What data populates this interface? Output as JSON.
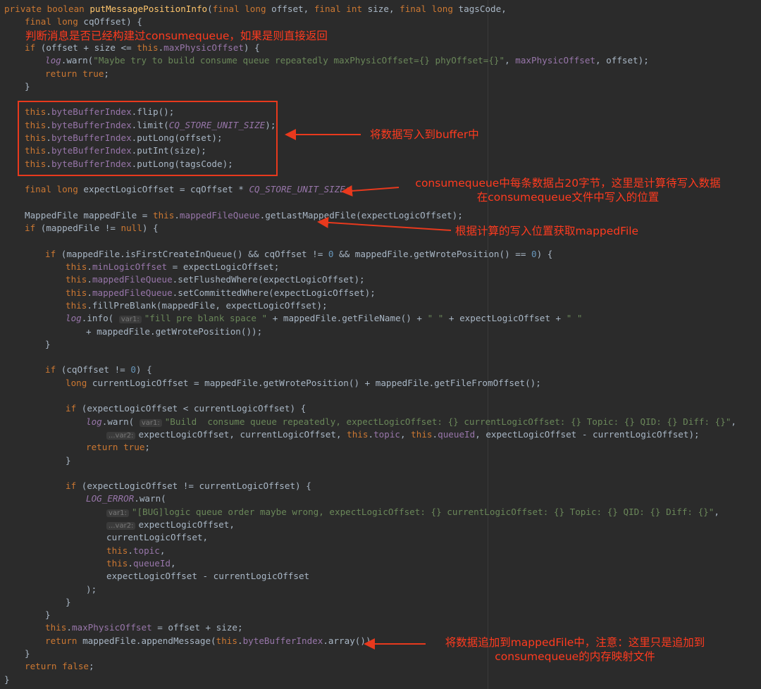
{
  "code_lines": [
    {
      "indent": 0,
      "segs": [
        {
          "t": "private boolean ",
          "c": "kw"
        },
        {
          "t": "putMessagePositionInfo",
          "c": "fn"
        },
        {
          "t": "("
        },
        {
          "t": "final long ",
          "c": "kw"
        },
        {
          "t": "offset, "
        },
        {
          "t": "final int ",
          "c": "kw"
        },
        {
          "t": "size, "
        },
        {
          "t": "final long ",
          "c": "kw"
        },
        {
          "t": "tagsCode,"
        }
      ]
    },
    {
      "indent": 1,
      "segs": [
        {
          "t": "final long ",
          "c": "kw"
        },
        {
          "t": "cqOffset) {"
        }
      ]
    },
    {
      "indent": 1,
      "blank": true,
      "segs": []
    },
    {
      "indent": 1,
      "segs": [
        {
          "t": "if ",
          "c": "kw"
        },
        {
          "t": "(offset + size <= "
        },
        {
          "t": "this",
          "c": "kw"
        },
        {
          "t": "."
        },
        {
          "t": "maxPhysicOffset",
          "c": "fld"
        },
        {
          "t": ") {"
        }
      ]
    },
    {
      "indent": 2,
      "segs": [
        {
          "t": "log",
          "c": "log"
        },
        {
          "t": ".warn("
        },
        {
          "t": "\"Maybe try to build consume queue repeatedly maxPhysicOffset={} phyOffset={}\"",
          "c": "str"
        },
        {
          "t": ", "
        },
        {
          "t": "maxPhysicOffset",
          "c": "fld"
        },
        {
          "t": ", offset);"
        }
      ]
    },
    {
      "indent": 2,
      "segs": [
        {
          "t": "return true",
          "c": "kw"
        },
        {
          "t": ";"
        }
      ]
    },
    {
      "indent": 1,
      "segs": [
        {
          "t": "}"
        }
      ]
    },
    {
      "indent": 1,
      "blank": true,
      "segs": []
    },
    {
      "indent": 1,
      "segs": [
        {
          "t": "this",
          "c": "kw"
        },
        {
          "t": "."
        },
        {
          "t": "byteBufferIndex",
          "c": "fld"
        },
        {
          "t": ".flip();"
        }
      ]
    },
    {
      "indent": 1,
      "segs": [
        {
          "t": "this",
          "c": "kw"
        },
        {
          "t": "."
        },
        {
          "t": "byteBufferIndex",
          "c": "fld"
        },
        {
          "t": ".limit("
        },
        {
          "t": "CQ_STORE_UNIT_SIZE",
          "c": "cst"
        },
        {
          "t": ");"
        }
      ]
    },
    {
      "indent": 1,
      "segs": [
        {
          "t": "this",
          "c": "kw"
        },
        {
          "t": "."
        },
        {
          "t": "byteBufferIndex",
          "c": "fld"
        },
        {
          "t": ".putLong(offset);"
        }
      ]
    },
    {
      "indent": 1,
      "segs": [
        {
          "t": "this",
          "c": "kw"
        },
        {
          "t": "."
        },
        {
          "t": "byteBufferIndex",
          "c": "fld"
        },
        {
          "t": ".putInt(size);"
        }
      ]
    },
    {
      "indent": 1,
      "segs": [
        {
          "t": "this",
          "c": "kw"
        },
        {
          "t": "."
        },
        {
          "t": "byteBufferIndex",
          "c": "fld"
        },
        {
          "t": ".putLong(tagsCode);"
        }
      ]
    },
    {
      "indent": 1,
      "blank": true,
      "segs": []
    },
    {
      "indent": 1,
      "segs": [
        {
          "t": "final long ",
          "c": "kw"
        },
        {
          "t": "expectLogicOffset = cqOffset * "
        },
        {
          "t": "CQ_STORE_UNIT_SIZE",
          "c": "cst"
        },
        {
          "t": ";"
        }
      ]
    },
    {
      "indent": 1,
      "blank": true,
      "segs": []
    },
    {
      "indent": 1,
      "segs": [
        {
          "t": "MappedFile mappedFile = "
        },
        {
          "t": "this",
          "c": "kw"
        },
        {
          "t": "."
        },
        {
          "t": "mappedFileQueue",
          "c": "fld"
        },
        {
          "t": ".getLastMappedFile(expectLogicOffset);"
        }
      ]
    },
    {
      "indent": 1,
      "segs": [
        {
          "t": "if ",
          "c": "kw"
        },
        {
          "t": "(mappedFile != "
        },
        {
          "t": "null",
          "c": "kw"
        },
        {
          "t": ") {"
        }
      ]
    },
    {
      "indent": 1,
      "blank": true,
      "segs": []
    },
    {
      "indent": 2,
      "segs": [
        {
          "t": "if ",
          "c": "kw"
        },
        {
          "t": "(mappedFile.isFirstCreateInQueue() && cqOffset != "
        },
        {
          "t": "0",
          "c": "num"
        },
        {
          "t": " && mappedFile.getWrotePosition() == "
        },
        {
          "t": "0",
          "c": "num"
        },
        {
          "t": ") {"
        }
      ]
    },
    {
      "indent": 3,
      "segs": [
        {
          "t": "this",
          "c": "kw"
        },
        {
          "t": "."
        },
        {
          "t": "minLogicOffset",
          "c": "fld"
        },
        {
          "t": " = expectLogicOffset;"
        }
      ]
    },
    {
      "indent": 3,
      "segs": [
        {
          "t": "this",
          "c": "kw"
        },
        {
          "t": "."
        },
        {
          "t": "mappedFileQueue",
          "c": "fld"
        },
        {
          "t": ".setFlushedWhere(expectLogicOffset);"
        }
      ]
    },
    {
      "indent": 3,
      "segs": [
        {
          "t": "this",
          "c": "kw"
        },
        {
          "t": "."
        },
        {
          "t": "mappedFileQueue",
          "c": "fld"
        },
        {
          "t": ".setCommittedWhere(expectLogicOffset);"
        }
      ]
    },
    {
      "indent": 3,
      "segs": [
        {
          "t": "this",
          "c": "kw"
        },
        {
          "t": ".fillPreBlank(mappedFile, expectLogicOffset);"
        }
      ]
    },
    {
      "indent": 3,
      "segs": [
        {
          "t": "log",
          "c": "log"
        },
        {
          "t": ".info( "
        },
        {
          "t": "var1:",
          "c": "hint"
        },
        {
          "t": "\"fill pre blank space \"",
          "c": "str"
        },
        {
          "t": " + mappedFile.getFileName() + "
        },
        {
          "t": "\" \"",
          "c": "str"
        },
        {
          "t": " + expectLogicOffset + "
        },
        {
          "t": "\" \"",
          "c": "str"
        }
      ]
    },
    {
      "indent": 4,
      "segs": [
        {
          "t": "+ mappedFile.getWrotePosition());"
        }
      ]
    },
    {
      "indent": 2,
      "segs": [
        {
          "t": "}"
        }
      ]
    },
    {
      "indent": 2,
      "blank": true,
      "segs": []
    },
    {
      "indent": 2,
      "segs": [
        {
          "t": "if ",
          "c": "kw"
        },
        {
          "t": "(cqOffset != "
        },
        {
          "t": "0",
          "c": "num"
        },
        {
          "t": ") {"
        }
      ]
    },
    {
      "indent": 3,
      "segs": [
        {
          "t": "long ",
          "c": "kw"
        },
        {
          "t": "currentLogicOffset = mappedFile.getWrotePosition() + mappedFile.getFileFromOffset();"
        }
      ]
    },
    {
      "indent": 3,
      "blank": true,
      "segs": []
    },
    {
      "indent": 3,
      "segs": [
        {
          "t": "if ",
          "c": "kw"
        },
        {
          "t": "(expectLogicOffset < currentLogicOffset) {"
        }
      ]
    },
    {
      "indent": 4,
      "segs": [
        {
          "t": "log",
          "c": "log"
        },
        {
          "t": ".warn( "
        },
        {
          "t": "var1:",
          "c": "hint"
        },
        {
          "t": "\"Build  consume queue repeatedly, expectLogicOffset: {} currentLogicOffset: {} Topic: {} QID: {} Diff: {}\"",
          "c": "str"
        },
        {
          "t": ","
        }
      ]
    },
    {
      "indent": 5,
      "segs": [
        {
          "t": "...var2:",
          "c": "hint"
        },
        {
          "t": "expectLogicOffset, currentLogicOffset, "
        },
        {
          "t": "this",
          "c": "kw"
        },
        {
          "t": "."
        },
        {
          "t": "topic",
          "c": "fld"
        },
        {
          "t": ", "
        },
        {
          "t": "this",
          "c": "kw"
        },
        {
          "t": "."
        },
        {
          "t": "queueId",
          "c": "fld"
        },
        {
          "t": ", expectLogicOffset - currentLogicOffset);"
        }
      ]
    },
    {
      "indent": 4,
      "segs": [
        {
          "t": "return true",
          "c": "kw"
        },
        {
          "t": ";"
        }
      ]
    },
    {
      "indent": 3,
      "segs": [
        {
          "t": "}"
        }
      ]
    },
    {
      "indent": 3,
      "blank": true,
      "segs": []
    },
    {
      "indent": 3,
      "segs": [
        {
          "t": "if ",
          "c": "kw"
        },
        {
          "t": "(expectLogicOffset != currentLogicOffset) {"
        }
      ]
    },
    {
      "indent": 4,
      "segs": [
        {
          "t": "LOG_ERROR",
          "c": "cst"
        },
        {
          "t": ".warn("
        }
      ]
    },
    {
      "indent": 5,
      "segs": [
        {
          "t": "var1:",
          "c": "hint"
        },
        {
          "t": "\"[BUG]logic queue order maybe wrong, expectLogicOffset: {} currentLogicOffset: {} Topic: {} QID: {} Diff: {}\"",
          "c": "str"
        },
        {
          "t": ","
        }
      ]
    },
    {
      "indent": 5,
      "segs": [
        {
          "t": "...var2:",
          "c": "hint"
        },
        {
          "t": "expectLogicOffset,"
        }
      ]
    },
    {
      "indent": 5,
      "segs": [
        {
          "t": "currentLogicOffset,"
        }
      ]
    },
    {
      "indent": 5,
      "segs": [
        {
          "t": "this",
          "c": "kw"
        },
        {
          "t": "."
        },
        {
          "t": "topic",
          "c": "fld"
        },
        {
          "t": ","
        }
      ]
    },
    {
      "indent": 5,
      "segs": [
        {
          "t": "this",
          "c": "kw"
        },
        {
          "t": "."
        },
        {
          "t": "queueId",
          "c": "fld"
        },
        {
          "t": ","
        }
      ]
    },
    {
      "indent": 5,
      "segs": [
        {
          "t": "expectLogicOffset - currentLogicOffset"
        }
      ]
    },
    {
      "indent": 4,
      "segs": [
        {
          "t": ");"
        }
      ]
    },
    {
      "indent": 3,
      "segs": [
        {
          "t": "}"
        }
      ]
    },
    {
      "indent": 2,
      "segs": [
        {
          "t": "}"
        }
      ]
    },
    {
      "indent": 2,
      "segs": [
        {
          "t": "this",
          "c": "kw"
        },
        {
          "t": "."
        },
        {
          "t": "maxPhysicOffset",
          "c": "fld"
        },
        {
          "t": " = offset + size;"
        }
      ]
    },
    {
      "indent": 2,
      "segs": [
        {
          "t": "return ",
          "c": "kw"
        },
        {
          "t": "mappedFile.appendMessage("
        },
        {
          "t": "this",
          "c": "kw"
        },
        {
          "t": "."
        },
        {
          "t": "byteBufferIndex",
          "c": "fld"
        },
        {
          "t": ".array());"
        }
      ]
    },
    {
      "indent": 1,
      "segs": [
        {
          "t": "}"
        }
      ]
    },
    {
      "indent": 1,
      "segs": [
        {
          "t": "return false",
          "c": "kw"
        },
        {
          "t": ";"
        }
      ]
    },
    {
      "indent": 0,
      "segs": [
        {
          "t": "}"
        }
      ]
    }
  ],
  "annotations": {
    "check_built": "判断消息是否已经构建过consumequeue，如果是则直接返回",
    "write_buffer": "将数据写入到buffer中",
    "calc_line1": "consumequeue中每条数据占20字节，这里是计算待写入数据",
    "calc_line2": "在consumequeue文件中写入的位置",
    "get_mapped": "根据计算的写入位置获取mappedFile",
    "append_line1": "将数据追加到mappedFile中，注意：这里只是追加到",
    "append_line2": "consumequeue的内存映射文件"
  },
  "colors": {
    "background": "#2b2b2b",
    "annotation_red": "#ff3b1f",
    "keyword": "#cc7832",
    "method": "#ffc66d",
    "field": "#9876aa",
    "string": "#6a8759",
    "number": "#6897bb",
    "default_text": "#a9b7c6"
  }
}
